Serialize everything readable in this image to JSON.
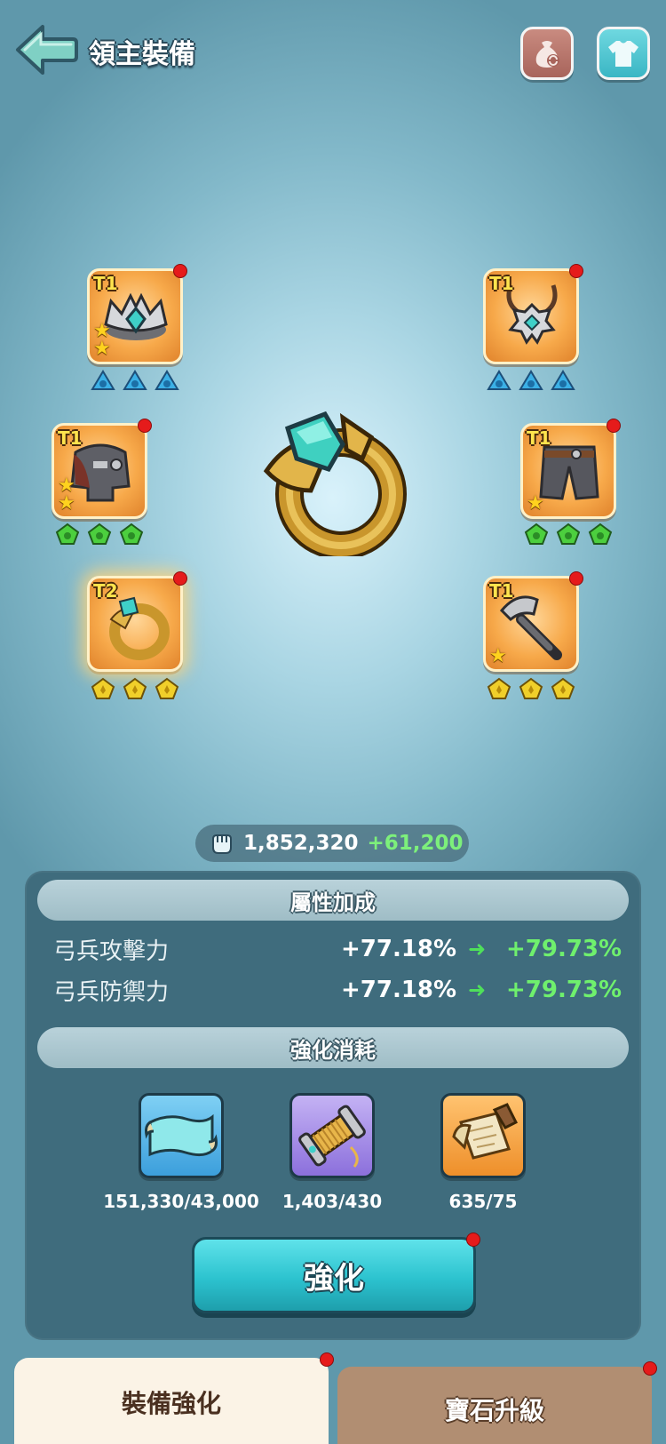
{
  "header": {
    "title": "領主裝備",
    "back_icon": "arrow-left-icon",
    "bag_icon": "bag-swap-icon",
    "shirt_icon": "shirt-icon"
  },
  "equipment": {
    "slots": [
      {
        "id": "crown",
        "tier": "T1",
        "stars": 2,
        "gem_color": "blue",
        "gems": 3,
        "has_notice": true
      },
      {
        "id": "amulet",
        "tier": "T1",
        "stars": 0,
        "gem_color": "blue",
        "gems": 3,
        "has_notice": true
      },
      {
        "id": "armor",
        "tier": "T1",
        "stars": 2,
        "gem_color": "green",
        "gems": 3,
        "has_notice": true
      },
      {
        "id": "pants",
        "tier": "T1",
        "stars": 1,
        "gem_color": "green",
        "gems": 3,
        "has_notice": true
      },
      {
        "id": "ring",
        "tier": "T2",
        "stars": 0,
        "gem_color": "yellow",
        "gems": 3,
        "has_notice": true,
        "selected": true
      },
      {
        "id": "hammer",
        "tier": "T1",
        "stars": 1,
        "gem_color": "yellow",
        "gems": 3,
        "has_notice": true
      }
    ],
    "selected_item_icon": "gold-ring-icon"
  },
  "power": {
    "icon": "fist-icon",
    "value": "1,852,320",
    "increase": "+61,200"
  },
  "attributes": {
    "header": "屬性加成",
    "rows": [
      {
        "name": "弓兵攻擊力",
        "current": "+77.18%",
        "next": "+79.73%"
      },
      {
        "name": "弓兵防禦力",
        "current": "+77.18%",
        "next": "+79.73%"
      }
    ]
  },
  "cost": {
    "header": "強化消耗",
    "materials": [
      {
        "icon": "cloth-scroll-icon",
        "count": "151,330/43,000",
        "color": "#4fb1e6"
      },
      {
        "icon": "thread-spool-icon",
        "count": "1,403/430",
        "color": "#9a7fe0"
      },
      {
        "icon": "blueprint-map-icon",
        "count": "635/75",
        "color": "#f3a03c"
      }
    ]
  },
  "enhance_button": "強化",
  "tabs": [
    {
      "label": "裝備強化",
      "active": true
    },
    {
      "label": "寶石升級",
      "active": false
    }
  ]
}
